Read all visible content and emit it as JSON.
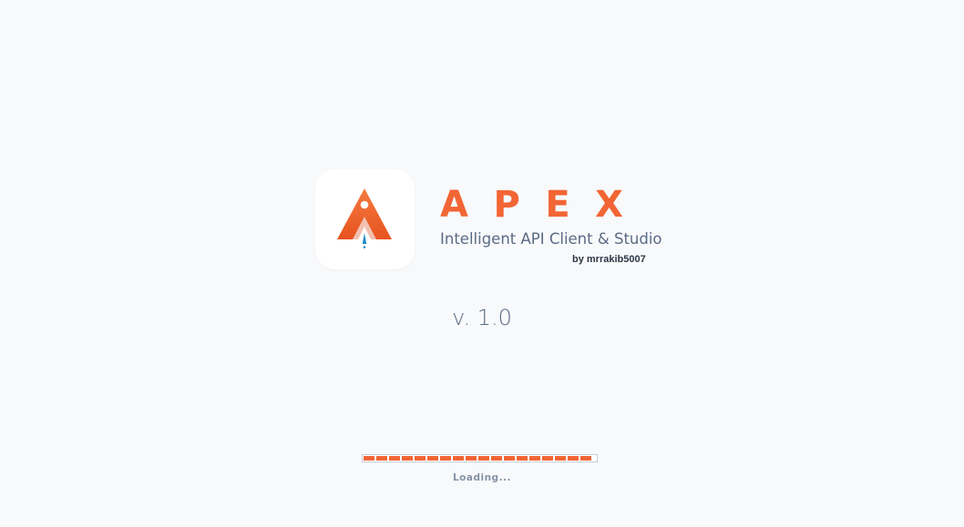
{
  "splash": {
    "logo_icon": "apex-rocket-logo-icon",
    "title": "APEX",
    "subtitle": "Intelligent API Client & Studio",
    "author": "by mrrakib5007",
    "version": "v. 1.0",
    "loading": {
      "label": "Loading...",
      "progress": 0.98
    }
  },
  "colors": {
    "accent": "#f26535",
    "accent_dark": "#d94e1f",
    "rocket_flame": "#1e88c8",
    "text_muted": "#5a6b85",
    "background": "#f8f9fb"
  }
}
